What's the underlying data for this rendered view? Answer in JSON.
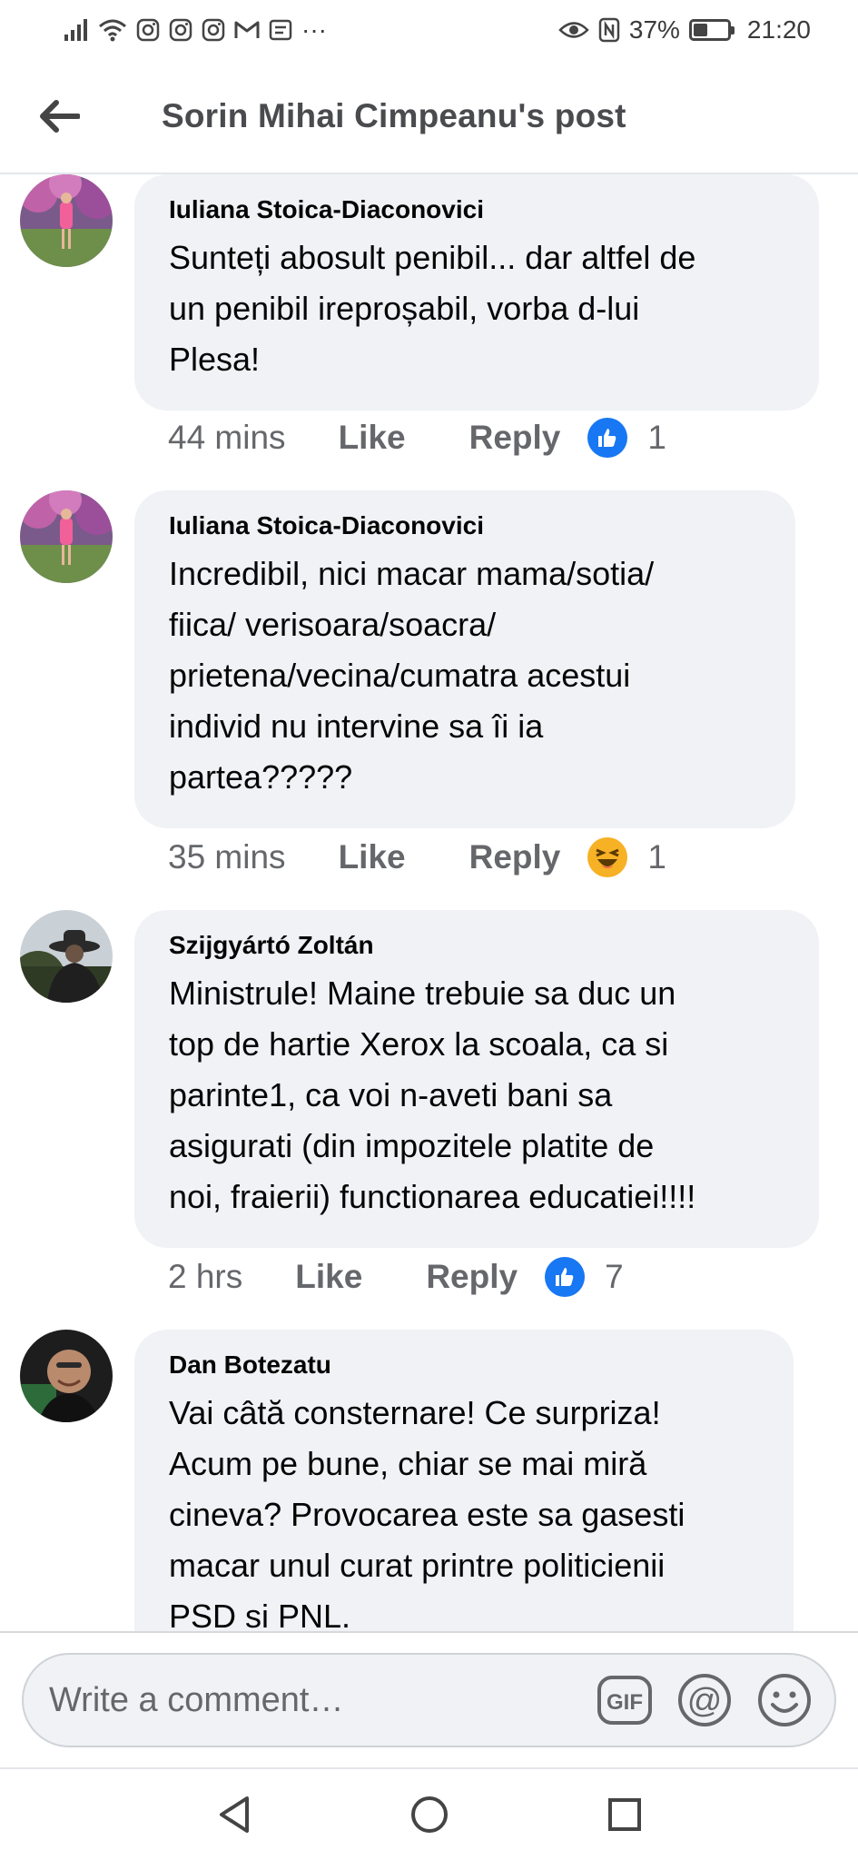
{
  "status_bar": {
    "battery": "37%",
    "battery_level": 0.37,
    "time": "21:20",
    "icons": [
      "signal-icon",
      "wifi-icon",
      "instagram-icon",
      "instagram-icon",
      "instagram-icon",
      "gmail-icon",
      "messages-icon",
      "more-icon",
      "eye-icon",
      "nfc-icon",
      "battery-icon"
    ],
    "more": "···"
  },
  "header": {
    "title": "Sorin Mihai Cimpeanu's post",
    "back_icon": "back-arrow-icon"
  },
  "comments": [
    {
      "author": "Iuliana Stoica-Diaconovici",
      "text": "Sunteți abosult penibil... dar altfel de\nun penibil ireproșabil,  vorba d-lui\nPlesa!",
      "time": "44 mins",
      "like": "Like",
      "reply": "Reply",
      "reaction": "like-reaction-icon",
      "reaction_count": "1"
    },
    {
      "author": "Iuliana Stoica-Diaconovici",
      "text": "Incredibil,  nici macar mama/sotia/\nfiica/ verisoara/soacra/\nprietena/vecina/cumatra acestui\nindivid nu intervine sa îi ia\npartea?????",
      "time": "35 mins",
      "like": "Like",
      "reply": "Reply",
      "reaction": "haha-reaction-icon",
      "reaction_count": "1"
    },
    {
      "author": "Szijgyártó Zoltán",
      "text": "Ministrule! Maine trebuie sa duc un\ntop de hartie Xerox la scoala, ca si\nparinte1, ca voi n-aveti bani sa\nasigurati (din impozitele platite de\nnoi, fraierii) functionarea educatiei!!!!",
      "time": "2 hrs",
      "like": "Like",
      "reply": "Reply",
      "reaction": "like-reaction-icon",
      "reaction_count": "7"
    },
    {
      "author": "Dan Botezatu",
      "text": "Vai câtă consternare! Ce surpriza!\nAcum pe bune, chiar se mai miră\ncineva? Provocarea este sa gasesti\nmacar unul curat printre politicienii\nPSD si PNL.",
      "time": "",
      "like": "",
      "reply": "",
      "reaction": "",
      "reaction_count": ""
    }
  ],
  "composer": {
    "placeholder": "Write a comment…",
    "gif_label": "GIF",
    "mention_label": "@"
  },
  "nav": {
    "icons": [
      "nav-back-icon",
      "nav-home-icon",
      "nav-recents-icon"
    ]
  },
  "colors": {
    "bubble": "#f0f2f5",
    "meta_text": "#65676b",
    "like_blue": "#1877f2",
    "haha_yellow": "#f7b125"
  }
}
